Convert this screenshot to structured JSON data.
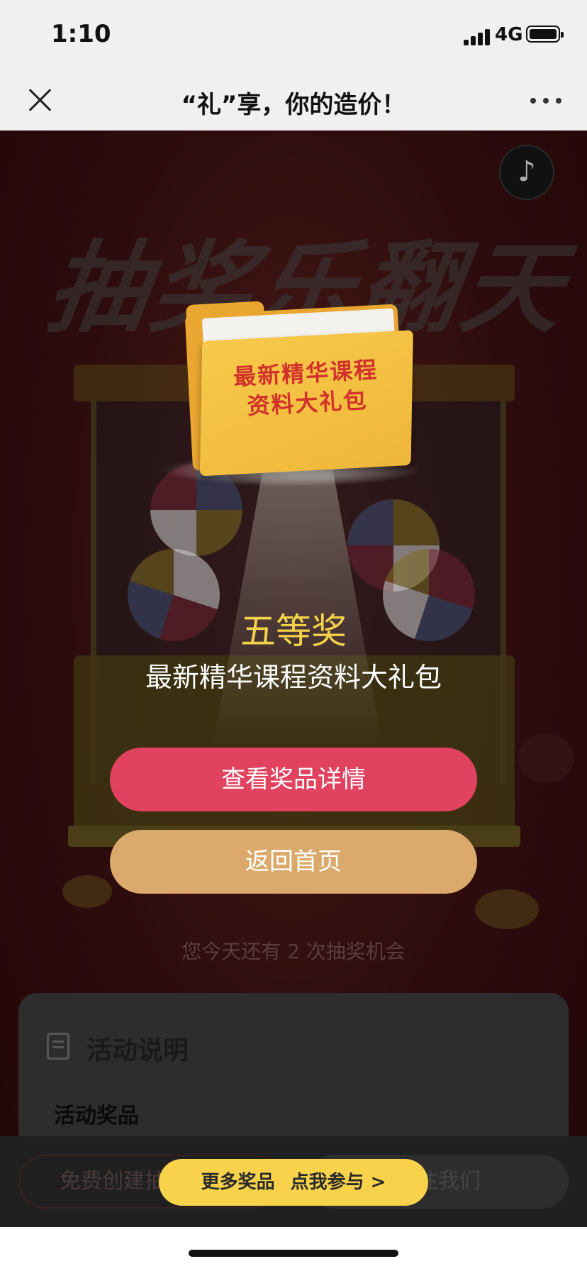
{
  "status_bar": {
    "time": "1:10",
    "network": "4G"
  },
  "nav": {
    "title": "“礼”享，你的造价！"
  },
  "hero": {
    "decor_title": "抽奖乐翻天",
    "folder_label_line1": "最新精华课程",
    "folder_label_line2": "资料大礼包"
  },
  "result": {
    "prize_level": "五等奖",
    "prize_name": "最新精华课程资料大礼包"
  },
  "buttons": {
    "view_details": "查看奖品详情",
    "back_home": "返回首页"
  },
  "chances": "您今天还有 2 次抽奖机会",
  "rules": {
    "title": "活动说明",
    "section_prize": "活动奖品"
  },
  "bottom": {
    "left_pill": "免费创建抽奖",
    "right_pill": "关注我们",
    "more_prizes": "更多奖品",
    "join": "点我参与 >"
  },
  "colors": {
    "accent_red": "#e0425f",
    "accent_gold": "#dba96c",
    "prize_yellow": "#f3d24a",
    "cta_yellow": "#f7d24a"
  },
  "icons": {
    "close": "close-icon",
    "more": "more-dots-icon",
    "music": "music-icon",
    "doc": "document-icon"
  }
}
